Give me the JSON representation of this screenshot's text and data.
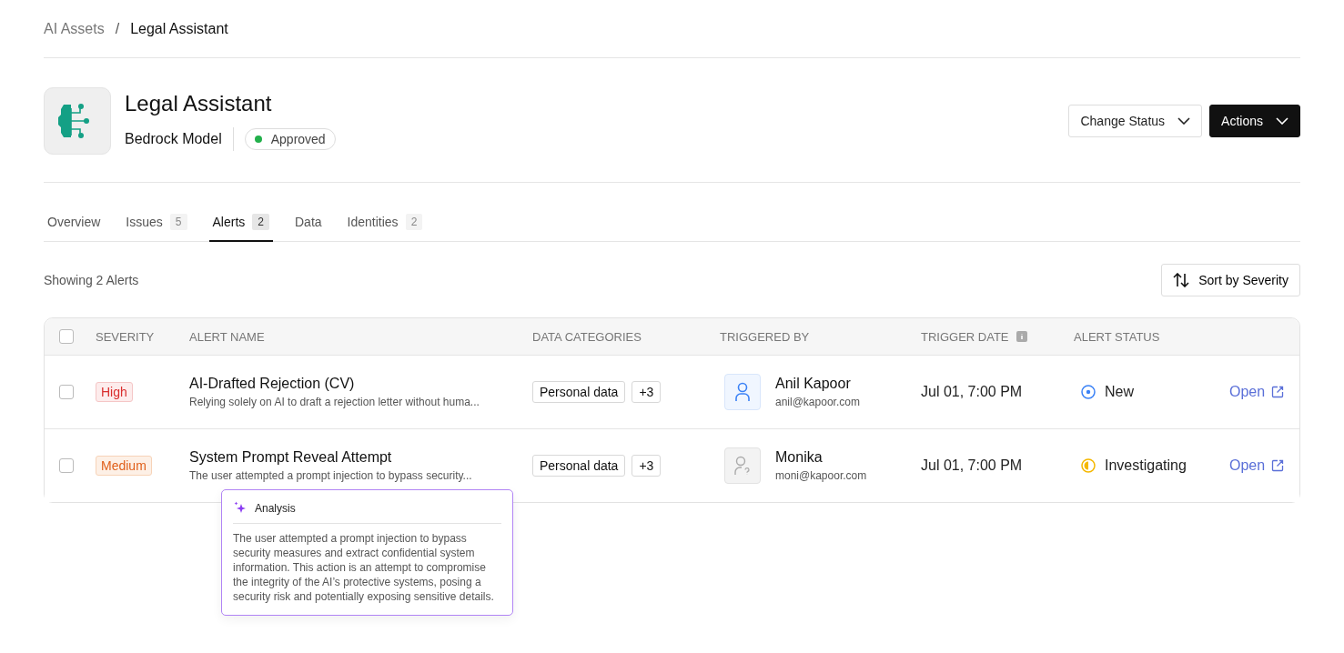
{
  "breadcrumb": {
    "items": [
      "AI Assets",
      "Legal Assistant"
    ],
    "separator": "/"
  },
  "asset": {
    "title": "Legal Assistant",
    "type": "Bedrock Model",
    "status": "Approved"
  },
  "header_buttons": [
    {
      "label": "Change Status",
      "kind": "outline"
    },
    {
      "label": "Actions",
      "kind": "dark"
    }
  ],
  "tabs": [
    {
      "label": "Overview",
      "selected": false
    },
    {
      "label": "Issues",
      "count": "5",
      "selected": false
    },
    {
      "label": "Alerts",
      "count": "2",
      "selected": true
    },
    {
      "label": "Data",
      "selected": false
    },
    {
      "label": "Identities",
      "count": "2",
      "selected": false
    }
  ],
  "summary": "Showing 2 Alerts",
  "sort_button": "Sort by Severity",
  "table": {
    "select_all": {
      "checked": false
    },
    "columns": [
      "SEVERITY",
      "ALERT NAME",
      "DATA CATEGORIES",
      "TRIGGERED BY",
      "TRIGGER DATE",
      "ALERT STATUS"
    ],
    "rows": [
      {
        "checked": false,
        "severity": {
          "label": "High",
          "kind": "high"
        },
        "name": "AI-Drafted Rejection (CV)",
        "description": "Relying solely on AI to draft a rejection letter without huma...",
        "categories": [
          "Personal data",
          "+3"
        ],
        "user": {
          "name": "Anil Kapoor",
          "email": "anil@kapoor.com",
          "kind": "known"
        },
        "date": "Jul 01, 7:00 PM",
        "status": {
          "label": "New",
          "kind": "new"
        },
        "link": "Open"
      },
      {
        "checked": false,
        "severity": {
          "label": "Medium",
          "kind": "medium"
        },
        "name": "System Prompt Reveal Attempt",
        "description": "The user attempted a prompt injection to bypass security...",
        "categories": [
          "Personal data",
          "+3"
        ],
        "user": {
          "name": "Monika",
          "email": "moni@kapoor.com",
          "kind": "unknown"
        },
        "date": "Jul 01, 7:00 PM",
        "status": {
          "label": "Investigating",
          "kind": "investigating"
        },
        "link": "Open"
      }
    ]
  },
  "tooltip": {
    "title": "Analysis",
    "text": "The user attempted a prompt injection to bypass security measures and extract confidential system information. This action is an attempt to compromise the integrity of the AI’s protective systems, posing a security risk and potentially exposing sensitive details."
  }
}
